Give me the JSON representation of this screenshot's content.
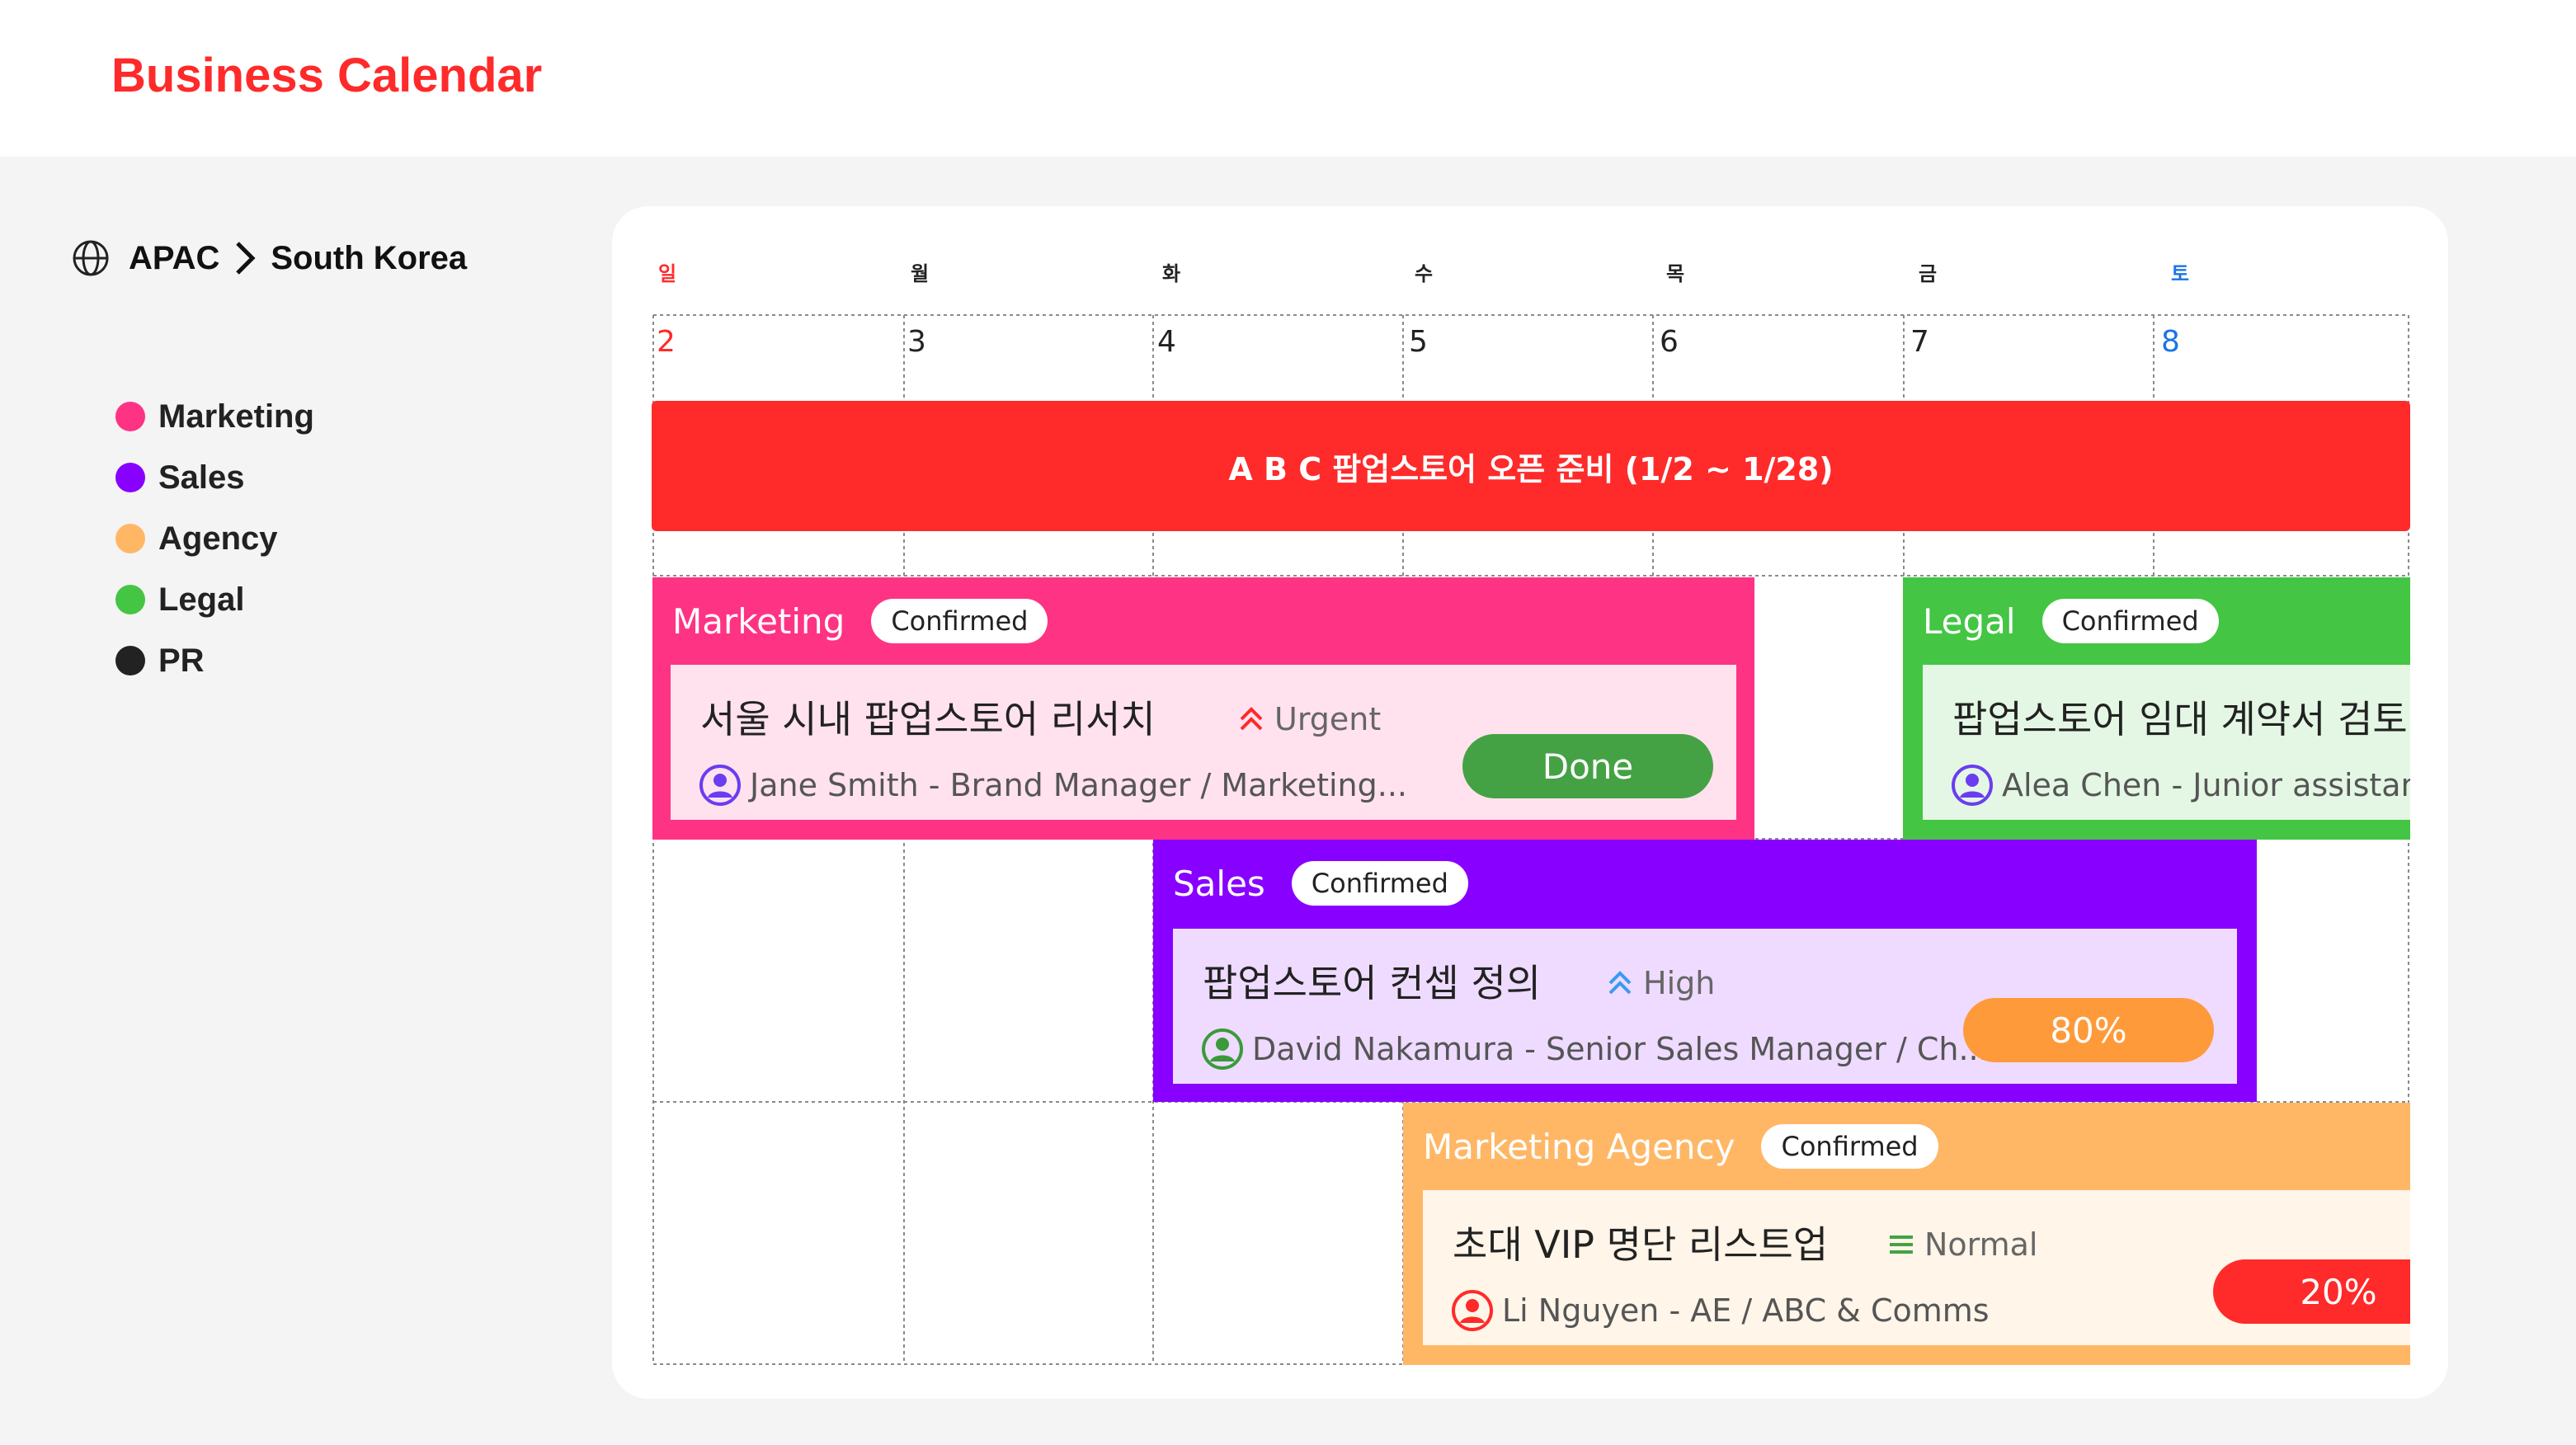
{
  "app": {
    "title": "Business Calendar"
  },
  "breadcrumb": {
    "region": "APAC",
    "country": "South Korea",
    "icon": "globe-icon",
    "separator_icon": "chevron-right-icon"
  },
  "legend": [
    {
      "label": "Marketing",
      "color": "#ff3384"
    },
    {
      "label": "Sales",
      "color": "#8800ff"
    },
    {
      "label": "Agency",
      "color": "#ffb766"
    },
    {
      "label": "Legal",
      "color": "#44c544"
    },
    {
      "label": "PR",
      "color": "#222222"
    }
  ],
  "calendar": {
    "weekdays": [
      {
        "label": "일",
        "color": "#ff2a2a"
      },
      {
        "label": "월",
        "color": "#222222"
      },
      {
        "label": "화",
        "color": "#222222"
      },
      {
        "label": "수",
        "color": "#222222"
      },
      {
        "label": "목",
        "color": "#222222"
      },
      {
        "label": "금",
        "color": "#222222"
      },
      {
        "label": "토",
        "color": "#1a73e8"
      }
    ],
    "dates": [
      {
        "label": "2",
        "color": "#ff2a2a"
      },
      {
        "label": "3",
        "color": "#222222"
      },
      {
        "label": "4",
        "color": "#222222"
      },
      {
        "label": "5",
        "color": "#222222"
      },
      {
        "label": "6",
        "color": "#222222"
      },
      {
        "label": "7",
        "color": "#222222"
      },
      {
        "label": "8",
        "color": "#1a73e8"
      }
    ],
    "banner": {
      "text": "A B C 팝업스토어 오픈 준비 (1/2 ~ 1/28)",
      "color": "#ff2a2a"
    }
  },
  "tasks": {
    "marketing": {
      "category": "Marketing",
      "status": "Confirmed",
      "color": "#ff3384",
      "title": "서울 시내 팝업스토어 리서치",
      "priority": {
        "label": "Urgent",
        "icon": "double-chevron-up-icon",
        "color": "#ff2a2a"
      },
      "assignee": "Jane Smith - Brand Manager / Marketing...",
      "assignee_icon_color": "#6a3df0",
      "progress": {
        "label": "Done",
        "color": "#44a244"
      }
    },
    "legal": {
      "category": "Legal",
      "status": "Confirmed",
      "color": "#44c544",
      "title": "팝업스토어 임대 계약서 검토",
      "assignee": "Alea Chen - Junior assistant",
      "assignee_icon_color": "#6a3df0"
    },
    "sales": {
      "category": "Sales",
      "status": "Confirmed",
      "color": "#8800ff",
      "title": "팝업스토어 컨셉 정의",
      "priority": {
        "label": "High",
        "icon": "double-chevron-up-icon",
        "color": "#3a9bf0"
      },
      "assignee": "David Nakamura - Senior Sales Manager / Ch...",
      "assignee_icon_color": "#3a9a3a",
      "progress": {
        "label": "80%",
        "value": 0.8,
        "color": "#ff9a3a"
      }
    },
    "agency": {
      "category": "Marketing Agency",
      "status": "Confirmed",
      "color": "#ffb766",
      "title": "초대 VIP 명단 리스트업",
      "priority": {
        "label": "Normal",
        "icon": "menu-lines-icon",
        "color": "#44a244"
      },
      "assignee": "Li Nguyen - AE / ABC & Comms",
      "assignee_icon_color": "#ff2a2a",
      "progress": {
        "label": "20%",
        "value": 0.2,
        "color": "#ff2a2a"
      }
    }
  }
}
